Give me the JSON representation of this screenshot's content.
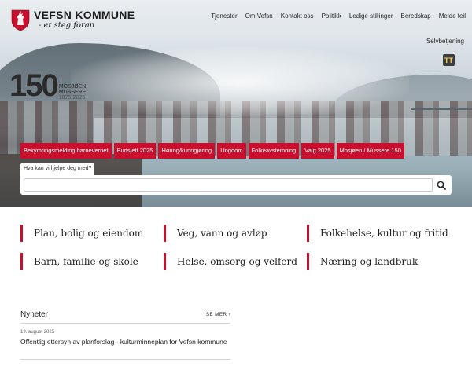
{
  "header": {
    "logo_name": "VEFSN KOMMUNE",
    "logo_tagline": "- et steg foran",
    "nav": [
      "Tjenester",
      "Om Vefsn",
      "Kontakt oss",
      "Politikk",
      "Ledige stillinger",
      "Beredskap",
      "Melde feil"
    ],
    "selfservice": "Selvbetjening",
    "text_size_button": "TT"
  },
  "anniversary": {
    "number": "150",
    "line1": "MOSJØEN",
    "line2": "MUSSERE",
    "years": "1875-2025"
  },
  "quicklinks": [
    "Bekymringsmelding barnevernet",
    "Budsjett 2025",
    "Høring/kunngjøring",
    "Ungdom",
    "Folkeavstemning",
    "Valg 2025",
    "Mosjøen / Mussere 150"
  ],
  "search": {
    "label": "Hva kan vi hjelpe deg med?",
    "placeholder": "",
    "value": ""
  },
  "categories": [
    "Plan, bolig og eiendom",
    "Veg, vann og avløp",
    "Folkehelse, kultur og fritid",
    "Barn, familie og skole",
    "Helse, omsorg og velferd",
    "Næring og landbruk"
  ],
  "news": {
    "title": "Nyheter",
    "more": "SE MER ›",
    "items": [
      {
        "date": "19. august 2025",
        "headline": "Offentlig ettersyn av planforslag - kulturminneplan for Vefsn kommune"
      }
    ]
  },
  "colors": {
    "accent_red": "#c8102e",
    "text_size_yellow": "#ffd94a"
  }
}
